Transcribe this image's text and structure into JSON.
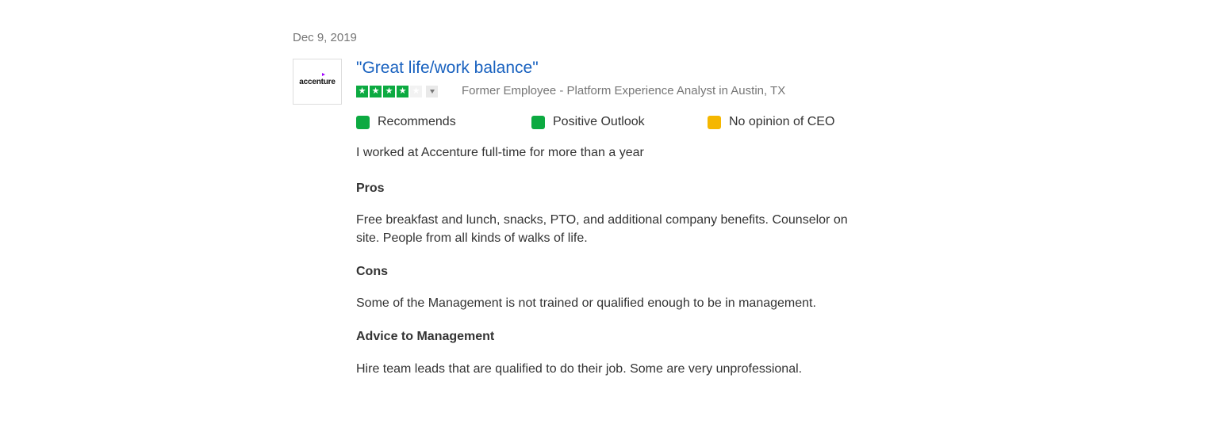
{
  "review": {
    "date": "Dec 9, 2019",
    "company_logo_text": "accenture",
    "title": "\"Great life/work balance\"",
    "rating": {
      "filled_stars": 4,
      "total_stars": 5
    },
    "author": "Former Employee - Platform Experience Analyst in Austin, TX",
    "indicators": [
      {
        "label": "Recommends",
        "color": "#0caa41"
      },
      {
        "label": "Positive Outlook",
        "color": "#0caa41"
      },
      {
        "label": "No opinion of CEO",
        "color": "#f5b700"
      }
    ],
    "employment": "I worked at Accenture full-time for more than a year",
    "pros": {
      "heading": "Pros",
      "text": "Free breakfast and lunch, snacks, PTO, and additional company benefits. Counselor on site. People from all kinds of walks of life."
    },
    "cons": {
      "heading": "Cons",
      "text": "Some of the Management is not trained or qualified enough to be in management."
    },
    "advice": {
      "heading": "Advice to Management",
      "text": "Hire team leads that are qualified to do their job. Some are very unprofessional."
    }
  },
  "colors": {
    "title_link": "#1861bf",
    "star_filled": "#0caa41",
    "star_empty": "#f2f2f2",
    "logo_accent": "#a100ff"
  }
}
